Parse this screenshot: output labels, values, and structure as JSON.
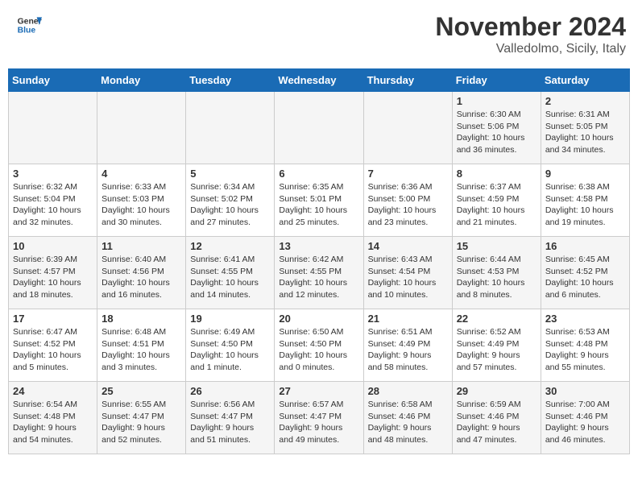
{
  "header": {
    "logo_line1": "General",
    "logo_line2": "Blue",
    "month": "November 2024",
    "location": "Valledolmo, Sicily, Italy"
  },
  "weekdays": [
    "Sunday",
    "Monday",
    "Tuesday",
    "Wednesday",
    "Thursday",
    "Friday",
    "Saturday"
  ],
  "weeks": [
    [
      {
        "day": "",
        "info": ""
      },
      {
        "day": "",
        "info": ""
      },
      {
        "day": "",
        "info": ""
      },
      {
        "day": "",
        "info": ""
      },
      {
        "day": "",
        "info": ""
      },
      {
        "day": "1",
        "info": "Sunrise: 6:30 AM\nSunset: 5:06 PM\nDaylight: 10 hours\nand 36 minutes."
      },
      {
        "day": "2",
        "info": "Sunrise: 6:31 AM\nSunset: 5:05 PM\nDaylight: 10 hours\nand 34 minutes."
      }
    ],
    [
      {
        "day": "3",
        "info": "Sunrise: 6:32 AM\nSunset: 5:04 PM\nDaylight: 10 hours\nand 32 minutes."
      },
      {
        "day": "4",
        "info": "Sunrise: 6:33 AM\nSunset: 5:03 PM\nDaylight: 10 hours\nand 30 minutes."
      },
      {
        "day": "5",
        "info": "Sunrise: 6:34 AM\nSunset: 5:02 PM\nDaylight: 10 hours\nand 27 minutes."
      },
      {
        "day": "6",
        "info": "Sunrise: 6:35 AM\nSunset: 5:01 PM\nDaylight: 10 hours\nand 25 minutes."
      },
      {
        "day": "7",
        "info": "Sunrise: 6:36 AM\nSunset: 5:00 PM\nDaylight: 10 hours\nand 23 minutes."
      },
      {
        "day": "8",
        "info": "Sunrise: 6:37 AM\nSunset: 4:59 PM\nDaylight: 10 hours\nand 21 minutes."
      },
      {
        "day": "9",
        "info": "Sunrise: 6:38 AM\nSunset: 4:58 PM\nDaylight: 10 hours\nand 19 minutes."
      }
    ],
    [
      {
        "day": "10",
        "info": "Sunrise: 6:39 AM\nSunset: 4:57 PM\nDaylight: 10 hours\nand 18 minutes."
      },
      {
        "day": "11",
        "info": "Sunrise: 6:40 AM\nSunset: 4:56 PM\nDaylight: 10 hours\nand 16 minutes."
      },
      {
        "day": "12",
        "info": "Sunrise: 6:41 AM\nSunset: 4:55 PM\nDaylight: 10 hours\nand 14 minutes."
      },
      {
        "day": "13",
        "info": "Sunrise: 6:42 AM\nSunset: 4:55 PM\nDaylight: 10 hours\nand 12 minutes."
      },
      {
        "day": "14",
        "info": "Sunrise: 6:43 AM\nSunset: 4:54 PM\nDaylight: 10 hours\nand 10 minutes."
      },
      {
        "day": "15",
        "info": "Sunrise: 6:44 AM\nSunset: 4:53 PM\nDaylight: 10 hours\nand 8 minutes."
      },
      {
        "day": "16",
        "info": "Sunrise: 6:45 AM\nSunset: 4:52 PM\nDaylight: 10 hours\nand 6 minutes."
      }
    ],
    [
      {
        "day": "17",
        "info": "Sunrise: 6:47 AM\nSunset: 4:52 PM\nDaylight: 10 hours\nand 5 minutes."
      },
      {
        "day": "18",
        "info": "Sunrise: 6:48 AM\nSunset: 4:51 PM\nDaylight: 10 hours\nand 3 minutes."
      },
      {
        "day": "19",
        "info": "Sunrise: 6:49 AM\nSunset: 4:50 PM\nDaylight: 10 hours\nand 1 minute."
      },
      {
        "day": "20",
        "info": "Sunrise: 6:50 AM\nSunset: 4:50 PM\nDaylight: 10 hours\nand 0 minutes."
      },
      {
        "day": "21",
        "info": "Sunrise: 6:51 AM\nSunset: 4:49 PM\nDaylight: 9 hours\nand 58 minutes."
      },
      {
        "day": "22",
        "info": "Sunrise: 6:52 AM\nSunset: 4:49 PM\nDaylight: 9 hours\nand 57 minutes."
      },
      {
        "day": "23",
        "info": "Sunrise: 6:53 AM\nSunset: 4:48 PM\nDaylight: 9 hours\nand 55 minutes."
      }
    ],
    [
      {
        "day": "24",
        "info": "Sunrise: 6:54 AM\nSunset: 4:48 PM\nDaylight: 9 hours\nand 54 minutes."
      },
      {
        "day": "25",
        "info": "Sunrise: 6:55 AM\nSunset: 4:47 PM\nDaylight: 9 hours\nand 52 minutes."
      },
      {
        "day": "26",
        "info": "Sunrise: 6:56 AM\nSunset: 4:47 PM\nDaylight: 9 hours\nand 51 minutes."
      },
      {
        "day": "27",
        "info": "Sunrise: 6:57 AM\nSunset: 4:47 PM\nDaylight: 9 hours\nand 49 minutes."
      },
      {
        "day": "28",
        "info": "Sunrise: 6:58 AM\nSunset: 4:46 PM\nDaylight: 9 hours\nand 48 minutes."
      },
      {
        "day": "29",
        "info": "Sunrise: 6:59 AM\nSunset: 4:46 PM\nDaylight: 9 hours\nand 47 minutes."
      },
      {
        "day": "30",
        "info": "Sunrise: 7:00 AM\nSunset: 4:46 PM\nDaylight: 9 hours\nand 46 minutes."
      }
    ]
  ]
}
